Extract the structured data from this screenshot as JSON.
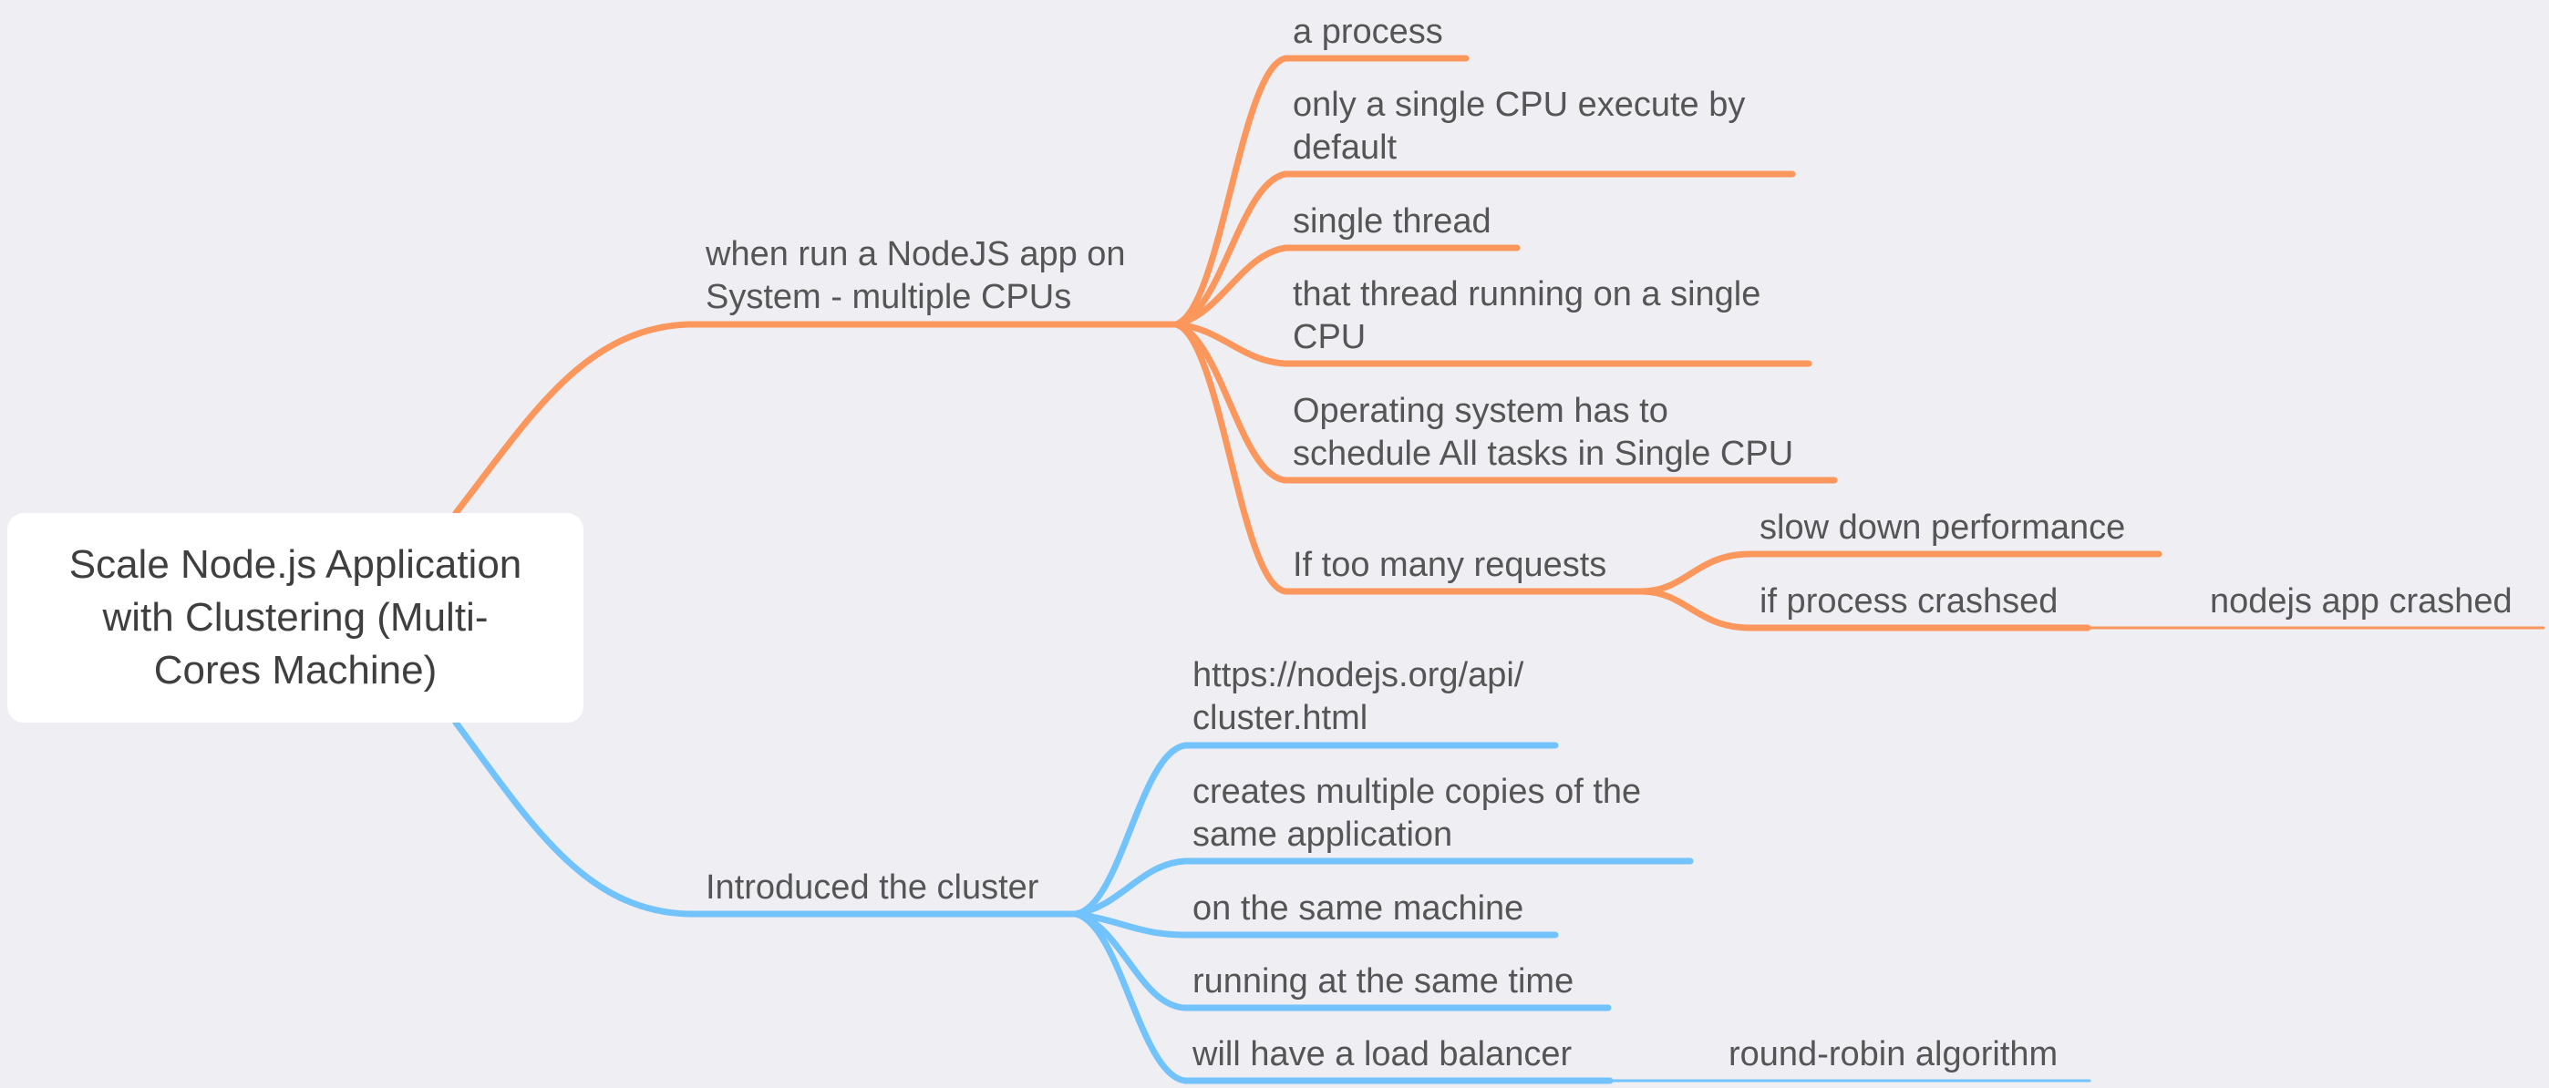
{
  "colors": {
    "background": "#efeef2",
    "branch_top": "#fb965c",
    "branch_bottom": "#72c3fb",
    "root_fill": "#ffffff",
    "text": "#555555"
  },
  "root": {
    "label": "Scale Node.js Application\nwith Clustering (Multi-\nCores Machine)"
  },
  "branches": [
    {
      "label": "when run a NodeJS app on\nSystem - multiple CPUs",
      "children": [
        {
          "label": "a process"
        },
        {
          "label": "only a single CPU execute by\ndefault"
        },
        {
          "label": "single thread"
        },
        {
          "label": "that thread running on a single\nCPU"
        },
        {
          "label": "Operating system has to\nschedule All tasks in Single CPU"
        },
        {
          "label": "If too many requests",
          "children": [
            {
              "label": "slow down performance"
            },
            {
              "label": "if process crashsed",
              "children": [
                {
                  "label": "nodejs app crashed"
                }
              ]
            }
          ]
        }
      ]
    },
    {
      "label": "Introduced the cluster",
      "children": [
        {
          "label": "https://nodejs.org/api/\ncluster.html"
        },
        {
          "label": "creates multiple copies of the\nsame application"
        },
        {
          "label": "on the same machine"
        },
        {
          "label": "running at the same time"
        },
        {
          "label": "will have a load balancer",
          "children": [
            {
              "label": "round-robin algorithm"
            }
          ]
        }
      ]
    }
  ]
}
